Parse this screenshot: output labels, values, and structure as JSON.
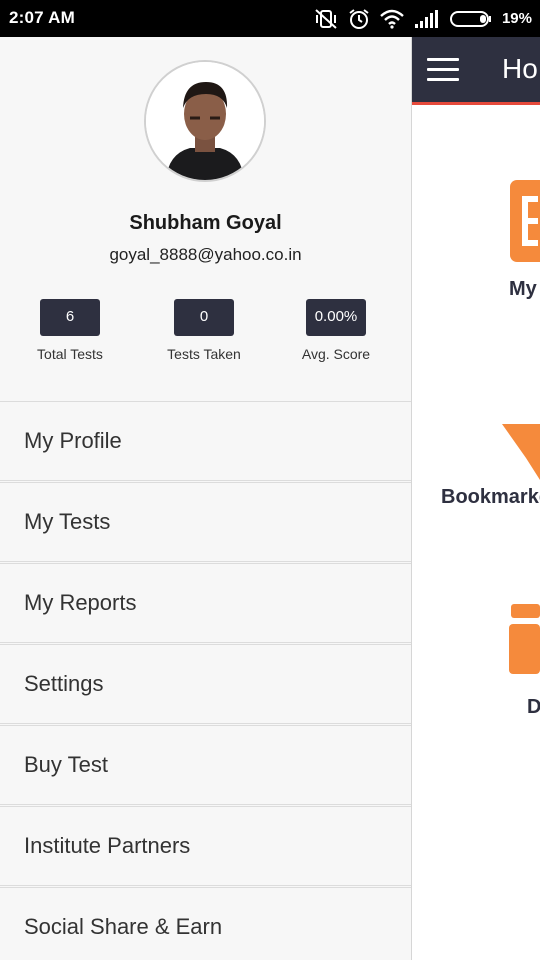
{
  "status_bar": {
    "time": "2:07 AM",
    "battery": "19%"
  },
  "home": {
    "title": "Ho",
    "tiles": [
      {
        "label": "My",
        "icon": "book-icon"
      },
      {
        "label": "Bookmarke",
        "icon": "star-icon"
      },
      {
        "label": "D",
        "icon": "download-box-icon"
      }
    ]
  },
  "drawer": {
    "user": {
      "name": "Shubham Goyal",
      "email": "goyal_8888@yahoo.co.in"
    },
    "stats": [
      {
        "value": "6",
        "label": "Total Tests"
      },
      {
        "value": "0",
        "label": "Tests Taken"
      },
      {
        "value": "0.00%",
        "label": "Avg. Score"
      }
    ],
    "menu": [
      {
        "label": "My Profile"
      },
      {
        "label": "My Tests"
      },
      {
        "label": "My Reports"
      },
      {
        "label": "Settings"
      },
      {
        "label": "Buy Test"
      },
      {
        "label": "Institute Partners"
      },
      {
        "label": "Social Share & Earn"
      }
    ]
  },
  "colors": {
    "header": "#2e3040",
    "accent": "#f58a3c",
    "header_line": "#e64a3b"
  }
}
